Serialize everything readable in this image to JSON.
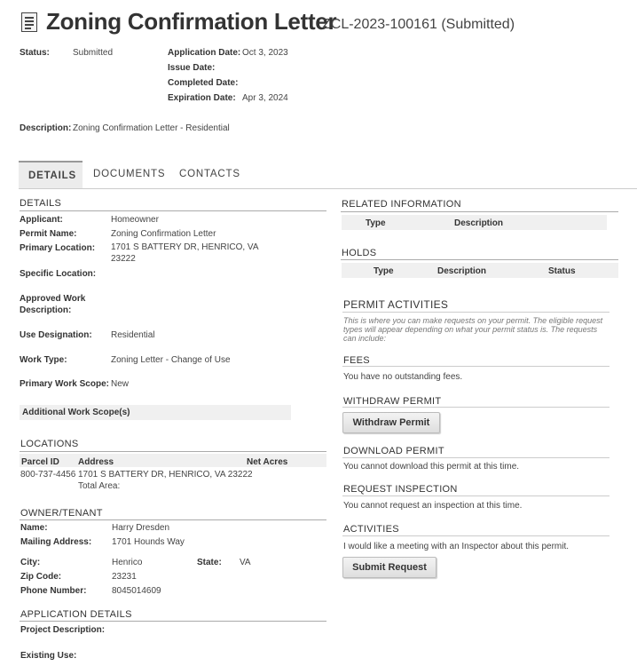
{
  "header": {
    "title": "Zoning Confirmation Letter",
    "record_id": "ZCL-2023-100161",
    "record_status": "(Submitted)"
  },
  "summary": {
    "status_label": "Status:",
    "status_value": "Submitted",
    "application_date_label": "Application Date:",
    "application_date_value": "Oct 3, 2023",
    "issue_date_label": "Issue Date:",
    "completed_date_label": "Completed Date:",
    "expiration_date_label": "Expiration Date:",
    "expiration_date_value": "Apr 3, 2024",
    "description_label": "Description:",
    "description_value": "Zoning Confirmation Letter - Residential"
  },
  "tabs": [
    {
      "label": "DETAILS"
    },
    {
      "label": "DOCUMENTS"
    },
    {
      "label": "CONTACTS"
    }
  ],
  "details": {
    "heading": "DETAILS",
    "applicant_label": "Applicant:",
    "applicant_value": "Homeowner",
    "permit_name_label": "Permit Name:",
    "permit_name_value": "Zoning Confirmation Letter",
    "primary_location_label": "Primary Location:",
    "primary_location_line1": "1701 S BATTERY DR, HENRICO, VA",
    "primary_location_line2": "23222",
    "specific_location_label": "Specific Location:",
    "approved_work_label_1": "Approved Work",
    "approved_work_label_2": "Description:",
    "use_designation_label": "Use Designation:",
    "use_designation_value": "Residential",
    "work_type_label": "Work Type:",
    "work_type_value": "Zoning Letter - Change of Use",
    "primary_work_scope_label": "Primary Work Scope:",
    "primary_work_scope_value": "New",
    "additional_work_scope_label": "Additional Work Scope(s)"
  },
  "locations": {
    "heading": "LOCATIONS",
    "col_parcel": "Parcel ID",
    "col_address": "Address",
    "col_net_acres": "Net Acres",
    "parcel_id": "800-737-4456",
    "address": "1701 S BATTERY DR, HENRICO, VA 23222",
    "total_area_label": "Total Area:"
  },
  "owner": {
    "heading": "OWNER/TENANT",
    "name_label": "Name:",
    "name_value": "Harry Dresden",
    "mailing_label": "Mailing Address:",
    "mailing_value": "1701 Hounds Way",
    "city_label": "City:",
    "city_value": "Henrico",
    "state_label": "State:",
    "state_value": "VA",
    "zip_label": "Zip Code:",
    "zip_value": "23231",
    "phone_label": "Phone Number:",
    "phone_value": "8045014609"
  },
  "application_details": {
    "heading": "APPLICATION DETAILS",
    "project_description_label": "Project Description:",
    "existing_use_label": "Existing Use:"
  },
  "related": {
    "heading": "RELATED INFORMATION",
    "col_type": "Type",
    "col_description": "Description"
  },
  "holds": {
    "heading": "HOLDS",
    "col_type": "Type",
    "col_description": "Description",
    "col_status": "Status"
  },
  "activities": {
    "heading": "PERMIT ACTIVITIES",
    "note": "This is where you can make requests on your permit. The eligible request types will appear depending on what your permit status is. The requests can include:",
    "fees_heading": "FEES",
    "fees_text": "You have no outstanding fees.",
    "withdraw_heading": "WITHDRAW PERMIT",
    "withdraw_button": "Withdraw Permit",
    "download_heading": "DOWNLOAD PERMIT",
    "download_text": "You cannot download this permit at this time.",
    "inspection_heading": "REQUEST INSPECTION",
    "inspection_text": "You cannot request an inspection at this time.",
    "activities_heading": "ACTIVITIES",
    "activities_text": "I would like a meeting with an Inspector about this permit.",
    "submit_button": "Submit Request"
  },
  "icons": {
    "document": "document-icon"
  }
}
